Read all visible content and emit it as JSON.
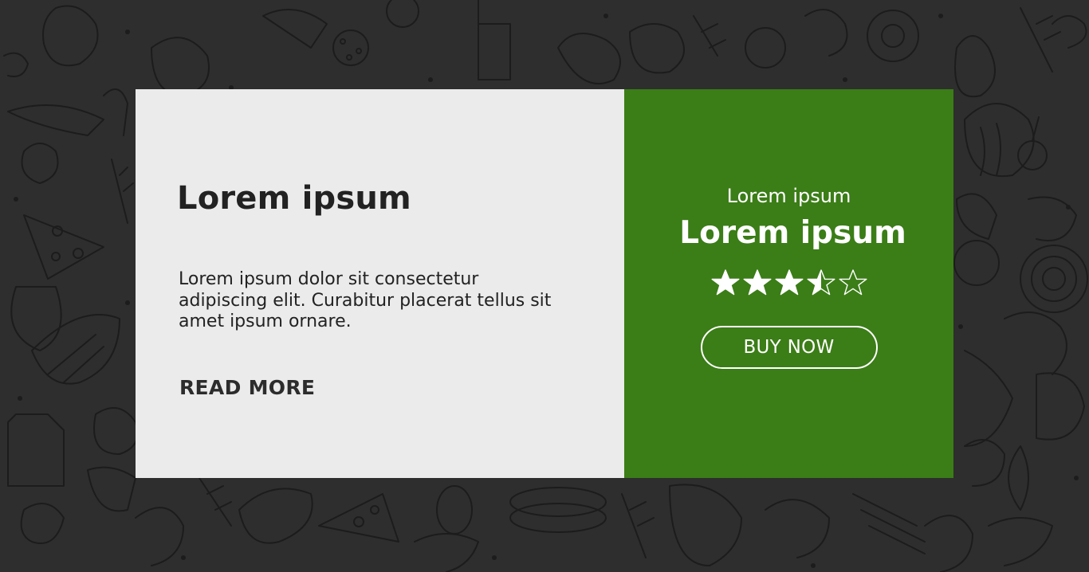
{
  "info_panel": {
    "title": "Lorem ipsum",
    "body": "Lorem ipsum dolor sit consectetur adipiscing elit. Curabitur placerat tellus sit amet ipsum ornare.",
    "read_more_label": "READ MORE"
  },
  "product_panel": {
    "subtitle": "Lorem ipsum",
    "title": "Lorem ipsum",
    "rating": 3.5,
    "rating_max": 5,
    "buy_label": "BUY NOW"
  },
  "colors": {
    "page_background": "#2e2e2e",
    "doodle_stroke": "#1b1b1b",
    "info_panel_background": "#ebebeb",
    "product_panel_background": "#3b7d17",
    "text_dark": "#222222",
    "text_light": "#ffffff"
  },
  "icons": {
    "rating_full": "star-filled-icon",
    "rating_half": "star-half-icon",
    "rating_empty": "star-outline-icon"
  }
}
